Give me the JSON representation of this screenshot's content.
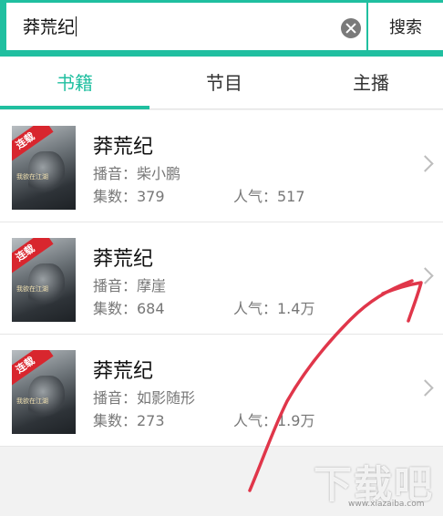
{
  "search": {
    "query": "莽荒纪",
    "button_label": "搜索"
  },
  "tabs": [
    {
      "label": "书籍",
      "active": true
    },
    {
      "label": "节目",
      "active": false
    },
    {
      "label": "主播",
      "active": false
    }
  ],
  "books": [
    {
      "title": "莽荒纪",
      "narrator": "播音：柴小鹏",
      "episodes": "集数：379",
      "popularity": "人气：517",
      "cover_tag": "连载",
      "cover_title": "我欲在江湖"
    },
    {
      "title": "莽荒纪",
      "narrator": "播音：摩崖",
      "episodes": "集数：684",
      "popularity": "人气：1.4万",
      "cover_tag": "连载",
      "cover_title": "我欲在江湖"
    },
    {
      "title": "莽荒纪",
      "narrator": "播音：如影随形",
      "episodes": "集数：273",
      "popularity": "人气：1.9万",
      "cover_tag": "连载",
      "cover_title": "我欲在江湖"
    }
  ],
  "watermark": {
    "main": "下载吧",
    "url": "www.xiazaiba.com"
  },
  "colors": {
    "accent": "#20bfa0",
    "annotation": "#e0364a",
    "cover_tag": "#d8262e"
  }
}
